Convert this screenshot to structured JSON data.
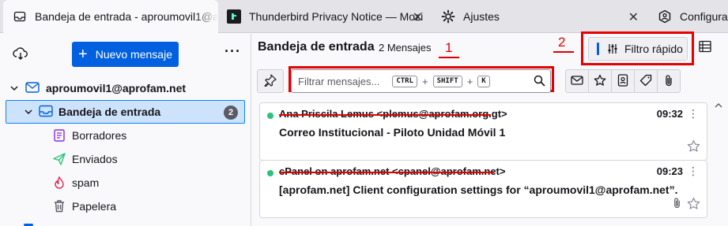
{
  "tabs": [
    {
      "label": "Bandeja de entrada - aproumovil1@ap",
      "icon": "inbox-icon"
    },
    {
      "label": "Thunderbird Privacy Notice — Mozi",
      "icon": "web-page-icon"
    },
    {
      "label": "Ajustes",
      "icon": "gear-icon"
    },
    {
      "label": "Configuraci",
      "icon": "account-settings-icon"
    }
  ],
  "folder_pane": {
    "new_message_label": "Nuevo mensaje",
    "account": "aproumovil1@aprofam.net",
    "folders": [
      {
        "label": "Bandeja de entrada",
        "badge": "2",
        "icon": "inbox-icon"
      },
      {
        "label": "Borradores",
        "icon": "drafts-icon"
      },
      {
        "label": "Enviados",
        "icon": "sent-icon"
      },
      {
        "label": "spam",
        "icon": "junk-icon"
      },
      {
        "label": "Papelera",
        "icon": "trash-icon"
      }
    ]
  },
  "list": {
    "title": "Bandeja de entrada",
    "count": "2 Mensajes",
    "annotation_1": "1",
    "annotation_2": "2",
    "quick_filter_label": "Filtro rápido",
    "search_placeholder": "Filtrar mensajes...",
    "shortcut_keys": [
      "CTRL",
      "SHIFT",
      "K"
    ],
    "messages": [
      {
        "from": "Ana Priscila Lemus <plemus@aprofam.org.gt>",
        "time": "09:32",
        "subject": "Correo Institucional - Piloto Unidad Móvil 1",
        "has_attachment": false
      },
      {
        "from": "cPanel on aprofam.net <cpanel@aprofam.net>",
        "time": "09:23",
        "subject": "[aprofam.net] Client configuration settings for “aproumovil1@aprofam.net”.",
        "has_attachment": true
      }
    ]
  },
  "colors": {
    "accent": "#0060df",
    "annotation": "#e60000",
    "unread": "#2ac37a"
  }
}
